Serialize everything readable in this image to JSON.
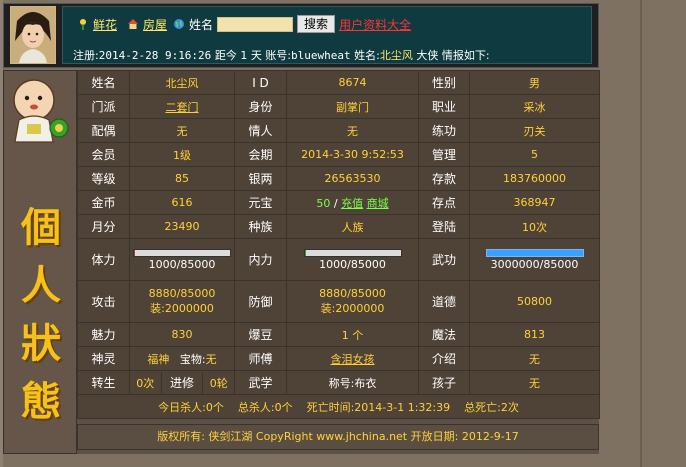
{
  "header": {
    "links": {
      "flower": "鲜花",
      "house": "房屋",
      "name_label": "姓名",
      "search_button": "搜索",
      "all_users": "用户资料大全"
    },
    "status": {
      "reg_label": "注册:",
      "reg_time": "2014-2-28 9:16:26",
      "since_label": "距今",
      "since_days": "1",
      "since_unit": "天",
      "account_label": "账号:",
      "account": "bluewheat",
      "name_label": "姓名:",
      "name": "北尘风",
      "title": "大侠",
      "info_tail": "情报如下:"
    }
  },
  "sidebar": {
    "title_chars": [
      "個",
      "人",
      "狀",
      "態"
    ]
  },
  "table": {
    "rows": [
      [
        "姓名",
        "北尘风",
        "I D",
        "8674",
        "性别",
        "男"
      ],
      [
        "门派",
        "二套门",
        "身份",
        "副掌门",
        "职业",
        "采冰"
      ],
      [
        "配偶",
        "无",
        "情人",
        "无",
        "练功",
        "刃关"
      ],
      [
        "会员",
        "1级",
        "会期",
        "2014-3-30 9:52:53",
        "管理",
        "5"
      ],
      [
        "等级",
        "85",
        "银两",
        "26563530",
        "存款",
        "183760000"
      ],
      [
        "金币",
        "616",
        "元宝",
        "",
        "存点",
        "368947"
      ],
      [
        "月分",
        "23490",
        "种族",
        "人族",
        "登陆",
        "10次"
      ]
    ],
    "yuanbao": {
      "value": "50",
      "sep": "/",
      "recharge": "充值",
      "shop": "商城"
    },
    "hp": {
      "label": "体力",
      "value": "1000/85000",
      "fill": 0.0118
    },
    "mp": {
      "label": "内力",
      "value": "1000/85000",
      "fill": 0.0118
    },
    "martial": {
      "label": "武功",
      "value": "3000000/85000",
      "fill": 1.0
    },
    "attack": {
      "label": "攻击",
      "line1": "8880/85000",
      "line2": "装:2000000"
    },
    "defense": {
      "label": "防御",
      "line1": "8880/85000",
      "line2": "装:2000000"
    },
    "morality": {
      "label": "道德",
      "value": "50800"
    },
    "charm": {
      "label": "魅力",
      "value": "830"
    },
    "burst": {
      "label": "爆豆",
      "value": "1 个"
    },
    "magic": {
      "label": "魔法",
      "value": "813"
    },
    "spirit": {
      "label": "神灵",
      "value": "福神",
      "treasure_label": "宝物:",
      "treasure_value": "无"
    },
    "master": {
      "label": "师傅",
      "value": "含泪女孩"
    },
    "intro": {
      "label": "介绍",
      "value": "无"
    },
    "rebirth": {
      "label": "转生",
      "value": "0次",
      "progress_label": "进修",
      "progress_value": "0轮"
    },
    "martial2": {
      "label": "武学",
      "title_label": "称号:",
      "title_value": "布衣"
    },
    "child": {
      "label": "孩子",
      "value": "无"
    }
  },
  "summary": {
    "today_kill_label": "今日杀人:",
    "today_kill": "0个",
    "total_kill_label": "总杀人:",
    "total_kill": "0个",
    "death_time_label": "死亡时间:",
    "death_time": "2014-3-1 1:32:39",
    "total_death_label": "总死亡:",
    "total_death": "2次"
  },
  "footer": {
    "text": "版权所有: 侠剑江湖 CopyRight www.jhchina.net   开放日期: 2012-9-17"
  },
  "colors": {
    "label_white": "#ffffff",
    "value_yellow": "#ffd23a",
    "link_green": "#7cff4a",
    "link_red": "#ff3333",
    "title_gold": "#f4c21a"
  }
}
